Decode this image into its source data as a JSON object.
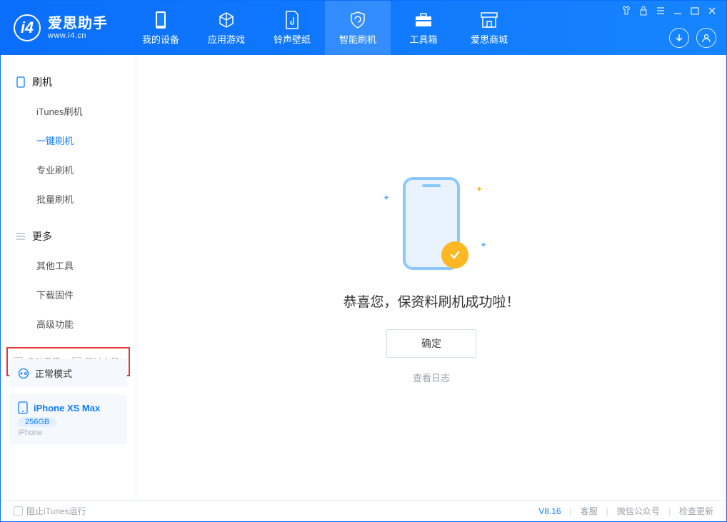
{
  "app": {
    "title": "爱思助手",
    "subtitle": "www.i4.cn"
  },
  "nav": {
    "items": [
      {
        "label": "我的设备"
      },
      {
        "label": "应用游戏"
      },
      {
        "label": "铃声壁纸"
      },
      {
        "label": "智能刷机"
      },
      {
        "label": "工具箱"
      },
      {
        "label": "爱思商城"
      }
    ]
  },
  "sidebar": {
    "section1": "刷机",
    "items1": [
      "iTunes刷机",
      "一键刷机",
      "专业刷机",
      "批量刷机"
    ],
    "section2": "更多",
    "items2": [
      "其他工具",
      "下载固件",
      "高级功能"
    ]
  },
  "device": {
    "mode_label": "正常模式",
    "name": "iPhone XS Max",
    "capacity": "256GB",
    "type": "iPhone"
  },
  "options": {
    "auto_activate": "自动激活",
    "skip_guide": "跳过向导"
  },
  "main": {
    "success_title": "恭喜您，保资料刷机成功啦！",
    "ok_button": "确定",
    "view_log": "查看日志"
  },
  "footer": {
    "stop_itunes": "阻止iTunes运行",
    "version": "V8.16",
    "support": "客服",
    "wechat": "微信公众号",
    "update": "检查更新"
  }
}
